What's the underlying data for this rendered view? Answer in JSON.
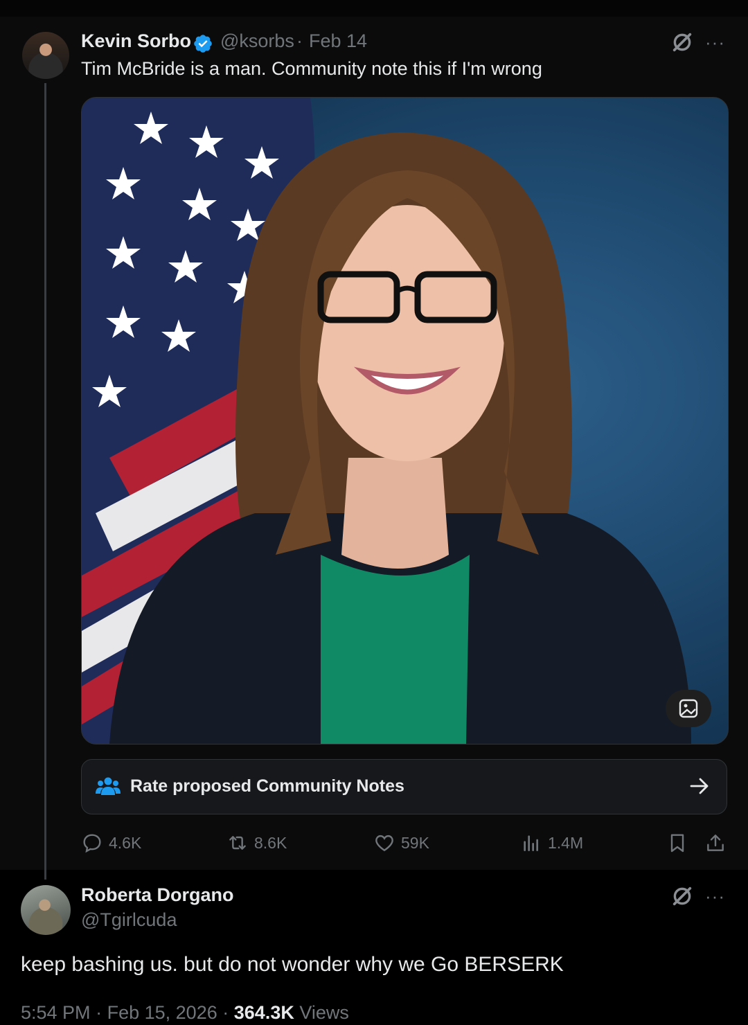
{
  "quoted_tweet": {
    "author_name": "Kevin Sorbo",
    "handle": "@ksorbs",
    "separator": "·",
    "date": "Feb 14",
    "text": "Tim McBride is a man. Community note this if I'm wrong",
    "community_notes_label": "Rate proposed Community Notes",
    "actions": {
      "replies": "4.6K",
      "reposts": "8.6K",
      "likes": "59K",
      "views": "1.4M"
    }
  },
  "reply_tweet": {
    "author_name": "Roberta Dorgano",
    "handle": "@Tgirlcuda",
    "text": "keep bashing us. but do not wonder why we Go BERSERK",
    "time": "5:54 PM",
    "sep1": "·",
    "date": "Feb 15, 2026",
    "sep2": "·",
    "views_count": "364.3K",
    "views_label": "Views"
  },
  "icons": {
    "more": "···",
    "verified": "verified-badge-icon",
    "grok": "grok-icon"
  },
  "colors": {
    "background": "#000000",
    "accent": "#1d9bf0",
    "muted": "#71767b",
    "text": "#e7e9ea"
  }
}
